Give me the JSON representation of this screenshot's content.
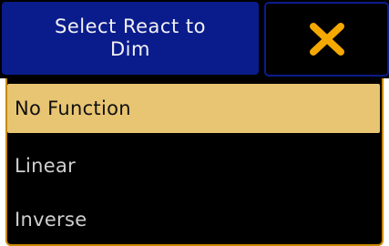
{
  "dialog": {
    "title": "Select React to\nDim",
    "close_icon": "close-x-icon",
    "colors": {
      "header_blue": "#0a1c8c",
      "close_x": "#f5a800",
      "selected_bg": "#e8c572",
      "frame": "#c88a00"
    }
  },
  "options": [
    {
      "label": "No Function",
      "selected": true
    },
    {
      "label": "Linear",
      "selected": false
    },
    {
      "label": "Inverse",
      "selected": false
    }
  ]
}
